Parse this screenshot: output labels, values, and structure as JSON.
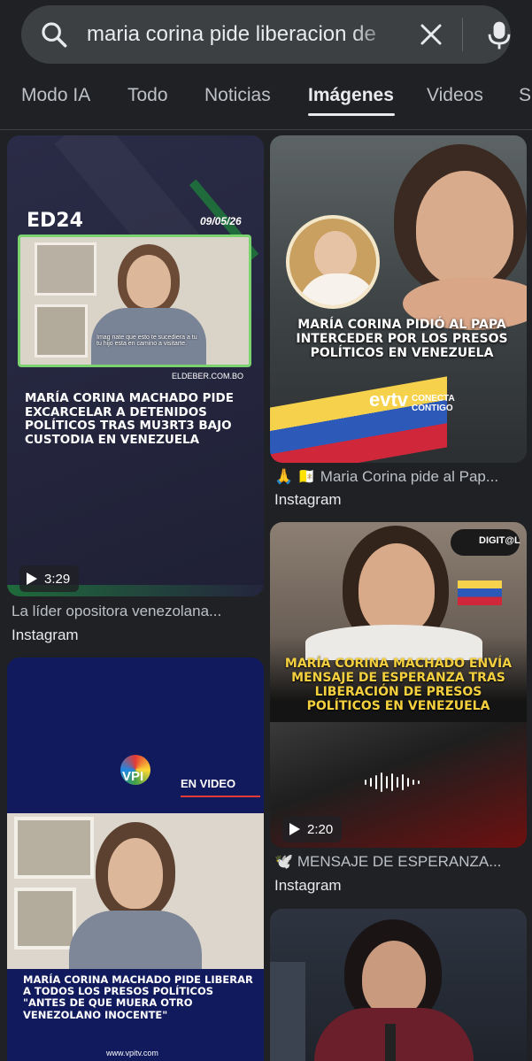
{
  "search": {
    "query": "maria corina pide liberacion de"
  },
  "tabs": [
    {
      "label": "Modo IA"
    },
    {
      "label": "Todo"
    },
    {
      "label": "Noticias"
    },
    {
      "label": "Imágenes"
    },
    {
      "label": "Videos"
    },
    {
      "label": "Sh"
    }
  ],
  "active_tab": "Imágenes",
  "results": [
    {
      "brand": "ED24",
      "date": "09/05/26",
      "subtitle": "Imag nate que esto te sucediera a tu\ntu hijo esta en camino a visitarte.",
      "site": "ELDEBER.COM.BO",
      "headline": "MARÍA CORINA MACHADO PIDE EXCARCELAR A DETENIDOS POLÍTICOS TRAS MU3RT3 BAJO CUSTODIA EN VENEZUELA",
      "duration": "3:29",
      "caption": "La líder opositora venezolana...",
      "source": "Instagram"
    },
    {
      "headline": "MARÍA CORINA PIDIÓ AL PAPA INTERCEDER POR LOS PRESOS POLÍTICOS EN VENEZUELA",
      "brand": "evtv",
      "brand_tag": "CONECTA CONTIGO",
      "caption": "🙏 🇻🇦 Maria Corina pide al Pap...",
      "source": "Instagram"
    },
    {
      "brand": "VPI",
      "brand_tag": "EN VIDEO",
      "headline": "MARÍA CORINA MACHADO PIDE LIBERAR A TODOS LOS PRESOS POLÍTICOS \"ANTES DE QUE MUERA OTRO VENEZOLANO INOCENTE\"",
      "site": "www.vpitv.com"
    },
    {
      "brand": "DIGIT@L",
      "headline": "MARÍA CORINA MACHADO ENVÍA MENSAJE DE ESPERANZA TRAS LIBERACIÓN DE PRESOS POLÍTICOS EN VENEZUELA",
      "duration": "2:20",
      "caption": "🕊️ MENSAJE DE ESPERANZA...",
      "source": "Instagram"
    }
  ],
  "colors": {
    "background": "#202124",
    "search_bg": "#3c4043",
    "headline_yellow": "#f4d03f",
    "green_frame": "#7bd36f"
  }
}
